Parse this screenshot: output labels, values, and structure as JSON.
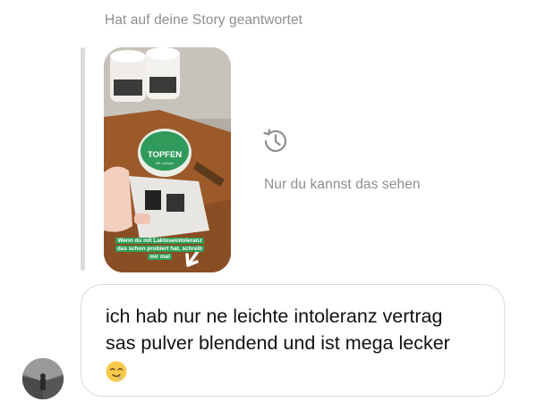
{
  "reply_header": {
    "label": "Hat auf deine Story geantwortet"
  },
  "story": {
    "caption": "Wenn du mit Laktoseintoleranz das schon probiert hat, schreib mir mal",
    "product_brand": "TOPFEN",
    "product_subtext": "Mit Laktose",
    "icon": "arrow-icon"
  },
  "privacy": {
    "icon": "history-icon",
    "text": "Nur du kannst das sehen"
  },
  "message": {
    "line1": "ich hab nur ne leichte intoleranz vertrag",
    "line2": "sas pulver blendend und ist mega lecker",
    "emoji": "🤤",
    "emoji_icon": "drooling-face-icon"
  },
  "sender": {
    "avatar": "avatar-photo"
  },
  "colors": {
    "secondary_text": "#8e8e8e",
    "bubble_border": "#dbdbdb",
    "caption_bg": "#2e9e57",
    "product_green": "#2f9a5a"
  }
}
